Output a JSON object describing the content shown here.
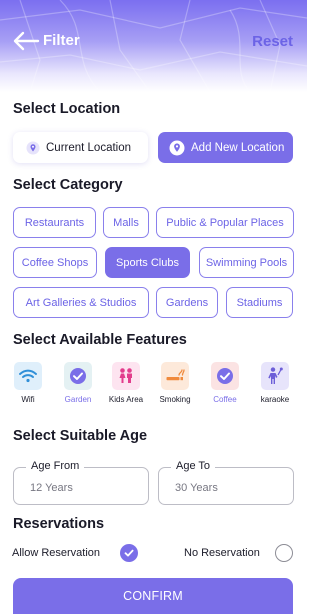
{
  "header": {
    "title": "Filter",
    "reset_label": "Reset"
  },
  "location": {
    "title": "Select Location",
    "current_label": "Current Location",
    "add_label": "Add New Location"
  },
  "category": {
    "title": "Select Category",
    "chips": [
      {
        "label": "Restaurants",
        "selected": false
      },
      {
        "label": "Malls",
        "selected": false
      },
      {
        "label": "Public & Popular Places",
        "selected": false
      },
      {
        "label": "Coffee Shops",
        "selected": false
      },
      {
        "label": "Sports Clubs",
        "selected": true
      },
      {
        "label": "Swimming Pools",
        "selected": false
      },
      {
        "label": "Art Galleries & Studios",
        "selected": false
      },
      {
        "label": "Gardens",
        "selected": false
      },
      {
        "label": "Stadiums",
        "selected": false
      }
    ]
  },
  "features": {
    "title": "Select Available Features",
    "items": [
      {
        "label": "Wifi",
        "icon": "wifi-icon",
        "selected": false
      },
      {
        "label": "Garden",
        "icon": "check-icon",
        "selected": true
      },
      {
        "label": "Kids Area",
        "icon": "kids-icon",
        "selected": false
      },
      {
        "label": "Smoking",
        "icon": "smoking-icon",
        "selected": false
      },
      {
        "label": "Coffee",
        "icon": "check-icon",
        "selected": true
      },
      {
        "label": "karaoke",
        "icon": "karaoke-icon",
        "selected": false
      }
    ]
  },
  "age": {
    "title": "Select Suitable Age",
    "from_label": "Age From",
    "from_value": "12 Years",
    "to_label": "Age To",
    "to_value": "30 Years"
  },
  "reservations": {
    "title": "Reservations",
    "allow_label": "Allow Reservation",
    "allow_selected": true,
    "no_label": "No Reservation"
  },
  "confirm_label": "CONFIRM",
  "colors": {
    "accent": "#7a6ee8",
    "accent_text": "#6c63e6"
  }
}
